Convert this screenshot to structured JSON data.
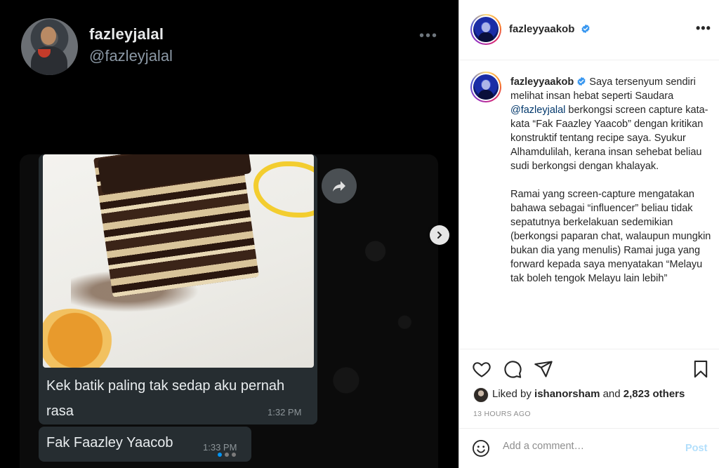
{
  "media": {
    "tweet": {
      "display_name": "fazleyjalal",
      "handle": "@fazleyjalal",
      "more": "•••",
      "emoji": "😅"
    },
    "chat": {
      "message1": "Kek batik paling tak sedap aku pernah rasa",
      "time1": "1:32 PM",
      "message2": "Fak Faazley Yaacob",
      "time2": "1:33 PM"
    },
    "carousel": {
      "count": 3,
      "active": 1
    }
  },
  "post": {
    "username": "fazleyyaakob",
    "more": "•••",
    "caption": {
      "p1_before": " Saya tersenyum sendiri melihat insan hebat seperti Saudara ",
      "mention": "@fazleyjalal",
      "p1_after": " berkongsi screen capture kata-kata “Fak Faazley Yaacob” dengan kritikan konstruktif tentang recipe saya. Syukur Alhamdulilah, kerana insan sehebat beliau sudi berkongsi dengan khalayak.",
      "p2": "Ramai yang screen-capture mengatakan bahawa sebagai “influencer” beliau tidak sepatutnya berkelakuan sedemikian (berkongsi paparan chat, walaupun mungkin bukan dia yang menulis) Ramai juga yang forward kepada saya menyatakan “Melayu tak boleh tengok Melayu lain lebih”"
    },
    "likes": {
      "prefix": "Liked by ",
      "user": "ishanorsham",
      "middle": " and ",
      "others": "2,823 others"
    },
    "time_ago": "13 HOURS AGO",
    "comment": {
      "placeholder": "Add a comment…",
      "post_label": "Post"
    }
  },
  "colors": {
    "verified": "#3897f0",
    "post_button_disabled": "#b2dffc",
    "mention": "#00376b"
  },
  "icons": [
    "heart-icon",
    "comment-icon",
    "share-icon",
    "bookmark-icon",
    "smiley-icon",
    "forward-icon",
    "chevron-right-icon",
    "verified-badge-icon"
  ]
}
